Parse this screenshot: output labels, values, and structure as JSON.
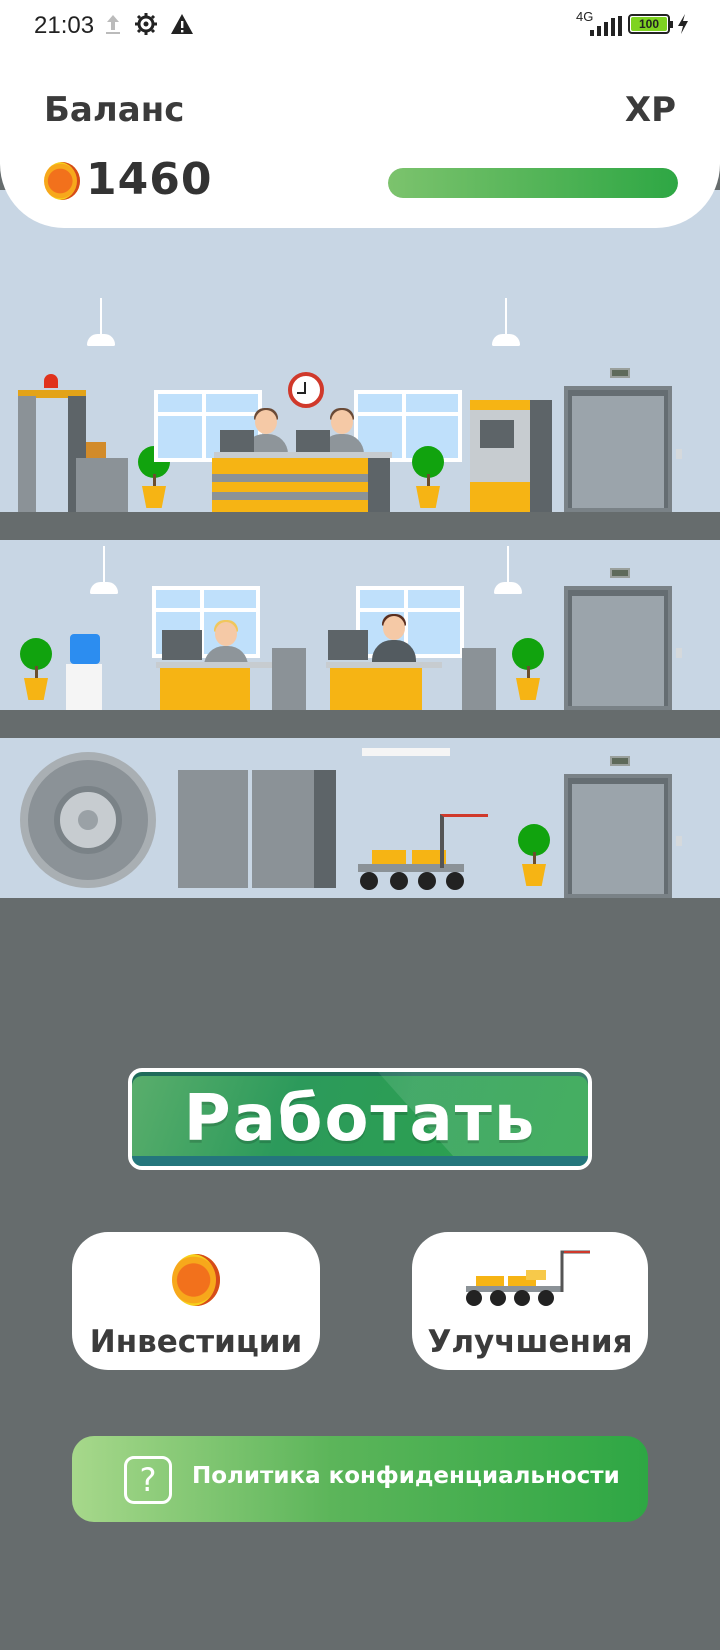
{
  "status_bar": {
    "time": "21:03",
    "network": "4G",
    "battery": "100",
    "icons": [
      "upload-icon",
      "settings-icon",
      "warning-icon",
      "signal-icon",
      "battery-icon",
      "charging-icon"
    ]
  },
  "header": {
    "balance_label": "Баланс",
    "balance_value": "1460",
    "xp_label": "XP",
    "xp_progress": 1.0
  },
  "actions": {
    "work_label": "Работать",
    "investments_label": "Инвестиции",
    "upgrades_label": "Улучшения",
    "privacy_label": "Политика конфиденциальности"
  },
  "colors": {
    "background": "#666c6d",
    "building_wall": "#c8d6e4",
    "accent_green": "#2ea744",
    "accent_yellow": "#f6b414",
    "coin_orange": "#f2711c"
  }
}
